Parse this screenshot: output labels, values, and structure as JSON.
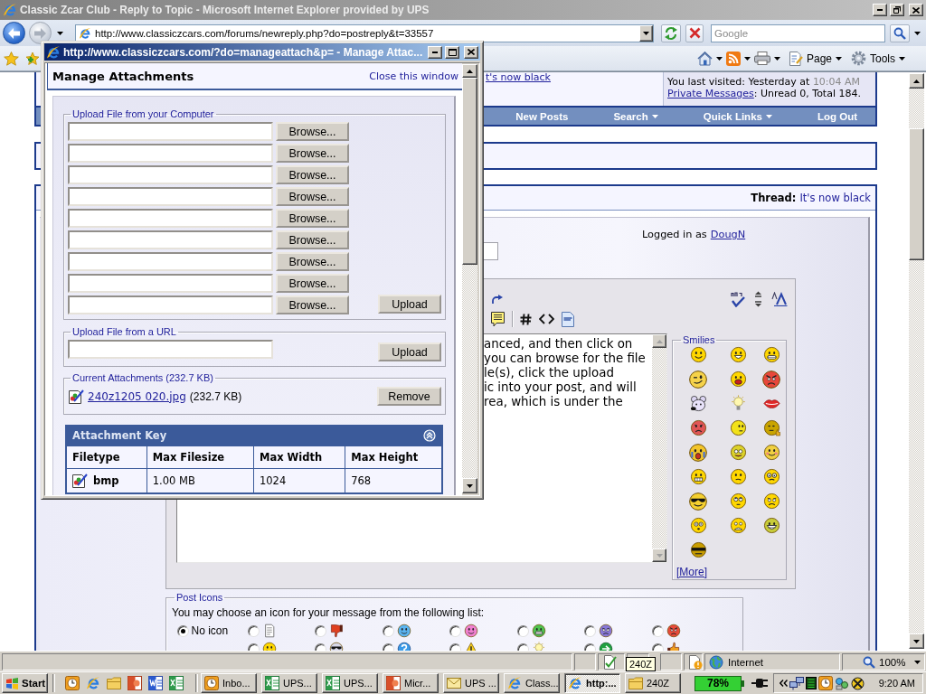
{
  "window": {
    "title": "Classic Zcar Club - Reply to Topic - Microsoft Internet Explorer provided by UPS"
  },
  "address_bar": {
    "url": "http://www.classiczcars.com/forums/newreply.php?do=postreply&t=33557"
  },
  "search": {
    "placeholder": "Google"
  },
  "command_bar": {
    "menus": [
      "Page",
      "Tools"
    ]
  },
  "page": {
    "header": {
      "thread_link": "t's now black",
      "last_visited": "You last visited: Yesterday at",
      "last_visited_time": "10:04 AM",
      "pm_link": "Private Messages",
      "pm_summary": ": Unread 0, Total 184."
    },
    "navbar": [
      {
        "label": "New Posts",
        "dropdown": false
      },
      {
        "label": "Search",
        "dropdown": true
      },
      {
        "label": "Quick Links",
        "dropdown": true
      },
      {
        "label": "Log Out",
        "dropdown": false
      }
    ],
    "thread": {
      "label": "Thread:",
      "title": "It's now black"
    },
    "logged_in": {
      "label": "Logged in as",
      "user": "DougN"
    },
    "message_lines": [
      "anced, and then click on",
      "you can browse for the file",
      "le(s), click the upload",
      "ic into your post, and will",
      "rea, which is under the"
    ],
    "smilies": {
      "legend": "Smilies",
      "more": "[More]"
    },
    "post_icons": {
      "legend": "Post Icons",
      "hint": "You may choose an icon for your message from the following list:",
      "rows": [
        {
          "options": [
            {
              "label": "No icon",
              "selected": true
            },
            {
              "selected": false
            },
            {
              "selected": false
            },
            {
              "selected": false
            },
            {
              "selected": false
            },
            {
              "selected": false
            },
            {
              "selected": false
            },
            {
              "selected": false
            }
          ]
        },
        {
          "options": [
            {
              "selected": false
            },
            {
              "selected": false
            },
            {
              "selected": false
            },
            {
              "selected": false
            },
            {
              "selected": false
            },
            {
              "selected": false
            },
            {
              "selected": false
            }
          ]
        }
      ]
    }
  },
  "popup": {
    "title": "http://www.classiczcars.com/?do=manageattach&p= - Manage Attac...",
    "heading": "Manage Attachments",
    "close_link": "Close this window",
    "computer_upload": {
      "legend": "Upload File from your Computer",
      "rows": [
        {
          "button": "Browse..."
        },
        {
          "button": "Browse..."
        },
        {
          "button": "Browse..."
        },
        {
          "button": "Browse..."
        },
        {
          "button": "Browse..."
        },
        {
          "button": "Browse..."
        },
        {
          "button": "Browse..."
        },
        {
          "button": "Browse..."
        },
        {
          "button": "Browse..."
        }
      ],
      "upload_button": "Upload"
    },
    "url_upload": {
      "legend": "Upload File from a URL",
      "upload_button": "Upload"
    },
    "current_attachments": {
      "legend": "Current Attachments (232.7 KB)",
      "files": [
        {
          "name": "240z1205 020.jpg",
          "size": "(232.7 KB)"
        }
      ],
      "remove_button": "Remove"
    },
    "attachment_key": {
      "title": "Attachment Key",
      "columns": [
        "Filetype",
        "Max Filesize",
        "Max Width",
        "Max Height"
      ],
      "rows": [
        [
          "bmp",
          "1.00 MB",
          "1024",
          "768"
        ]
      ]
    }
  },
  "status_bar": {
    "zone": "Internet",
    "zoom": "100%"
  },
  "tooltip": {
    "text": "240Z"
  },
  "taskbar": {
    "start": "Start",
    "tasks": [
      {
        "label": "Inbo...",
        "kind": "clock",
        "selected": false
      },
      {
        "label": "UPS...",
        "kind": "sheet",
        "selected": false
      },
      {
        "label": "UPS...",
        "kind": "sheet",
        "selected": false
      },
      {
        "label": "Micr...",
        "kind": "slides",
        "selected": false
      },
      {
        "label": "UPS ...",
        "kind": "mail",
        "selected": false
      },
      {
        "label": "Class...",
        "kind": "browser",
        "selected": false
      },
      {
        "label": "http:...",
        "kind": "browser",
        "selected": true
      },
      {
        "label": "240Z",
        "kind": "folder",
        "selected": false
      }
    ],
    "battery": "78%",
    "clock": "9:20 AM"
  }
}
